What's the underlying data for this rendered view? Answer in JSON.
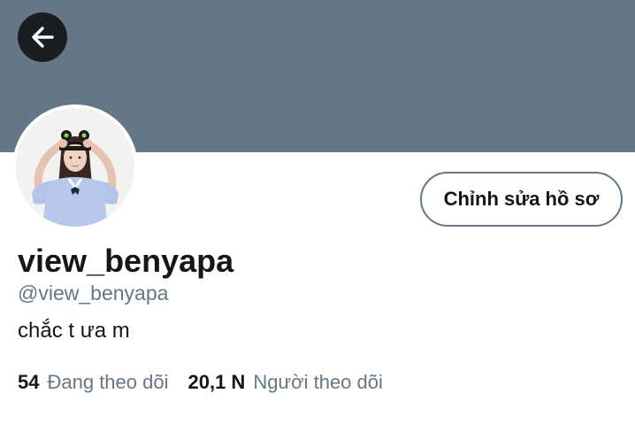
{
  "header": {
    "back_icon": "arrow-left-icon",
    "banner_color": "#657786"
  },
  "profile": {
    "display_name": "view_benyapa",
    "handle": "@view_benyapa",
    "bio": "chắc t ưa m",
    "edit_button_label": "Chỉnh sửa hồ sơ",
    "avatar_icon": "profile-photo"
  },
  "stats": {
    "following": {
      "count": "54",
      "label": "Đang theo dõi"
    },
    "followers": {
      "count": "20,1 N",
      "label": "Người theo dõi"
    }
  },
  "colors": {
    "primary_text": "#14171a",
    "secondary_text": "#657786",
    "back_button_bg": "#1a1d21"
  }
}
